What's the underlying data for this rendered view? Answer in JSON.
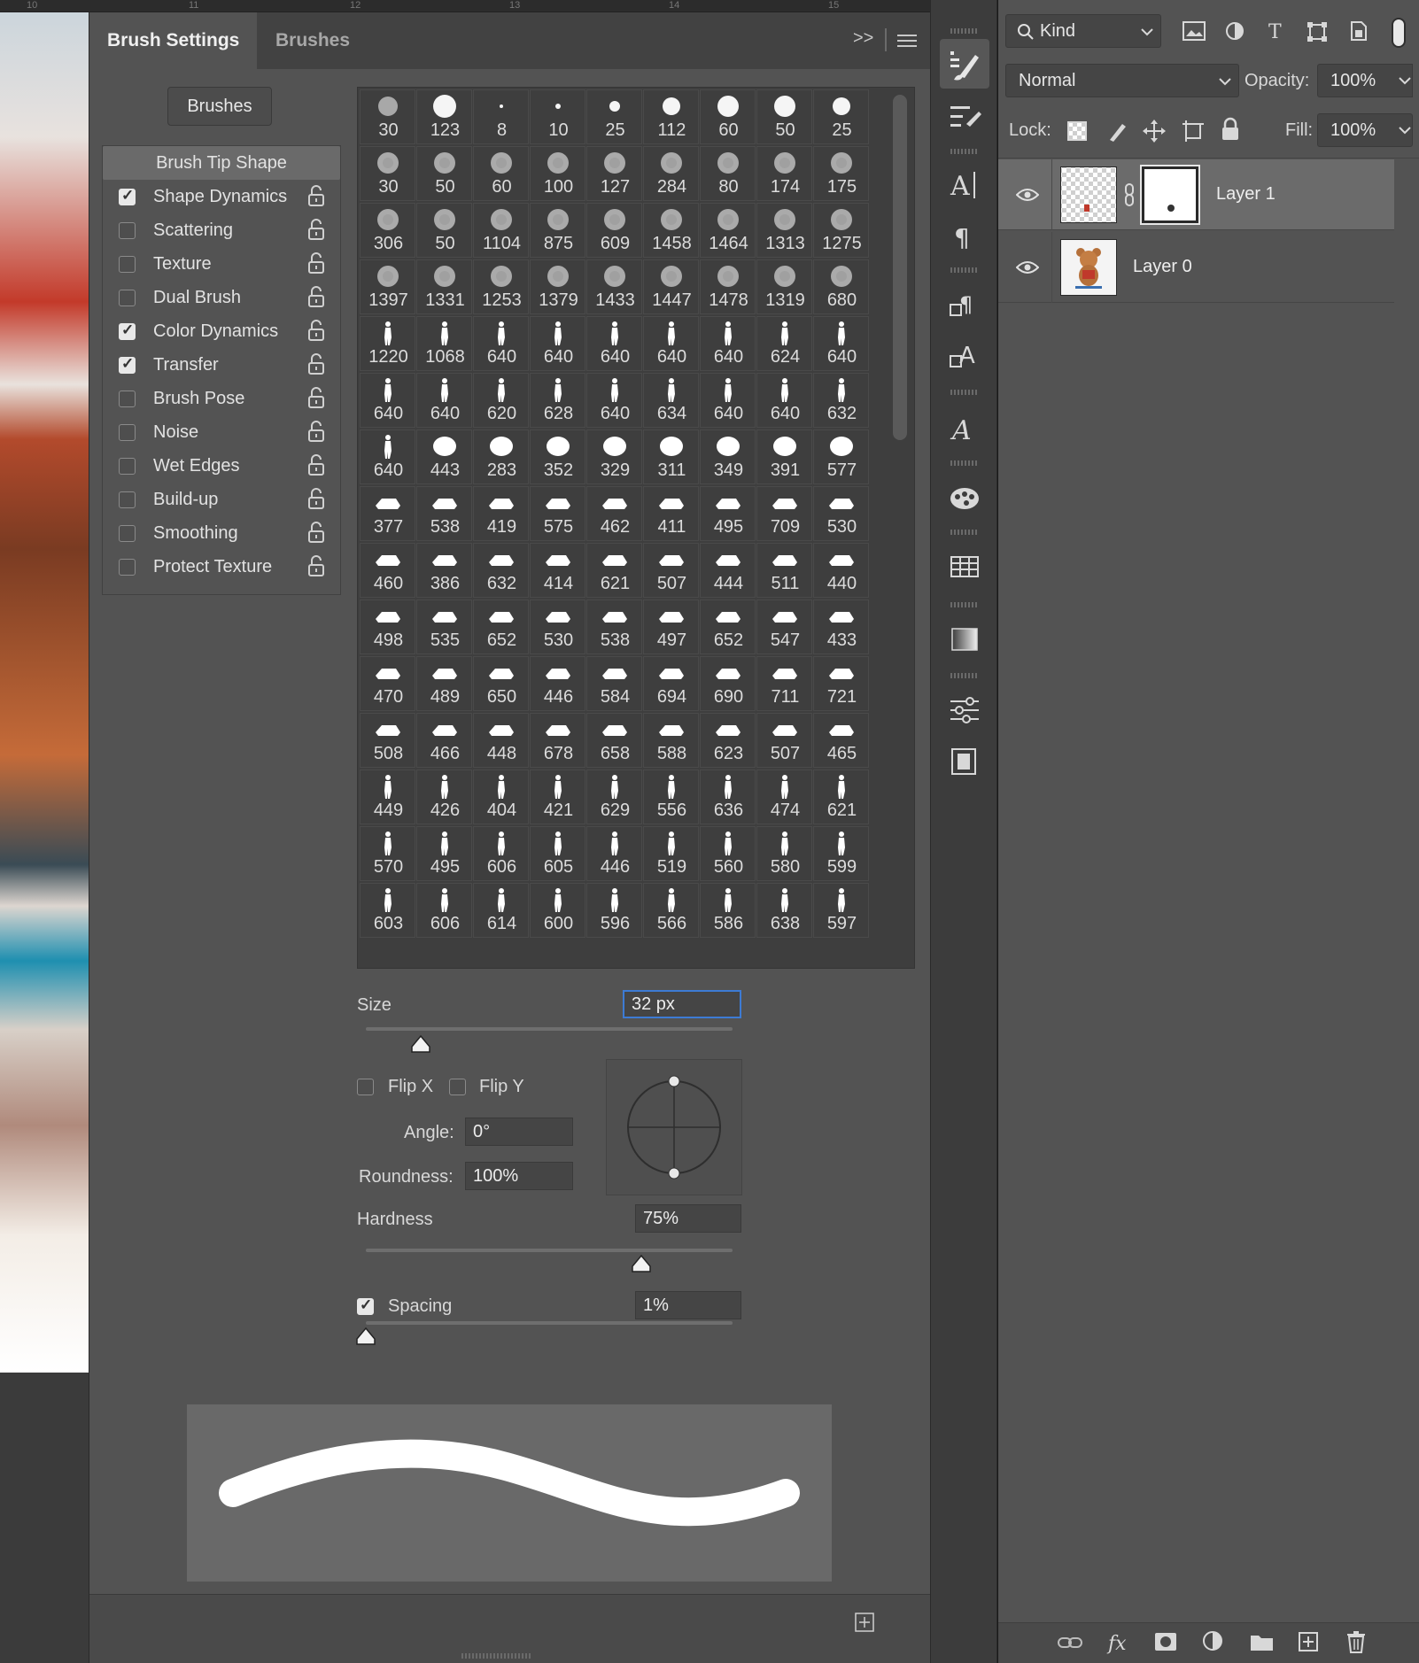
{
  "ruler": {
    "marks": [
      "10",
      "11",
      "12",
      "13",
      "14",
      "15"
    ]
  },
  "brush_settings": {
    "tabs": [
      {
        "label": "Brush Settings"
      },
      {
        "label": "Brushes"
      }
    ],
    "collapse_glyph": ">>",
    "brushes_button": "Brushes",
    "options": [
      {
        "label": "Brush Tip Shape",
        "header": true
      },
      {
        "label": "Shape Dynamics",
        "checked": true
      },
      {
        "label": "Scattering",
        "checked": false
      },
      {
        "label": "Texture",
        "checked": false
      },
      {
        "label": "Dual Brush",
        "checked": false
      },
      {
        "label": "Color Dynamics",
        "checked": true
      },
      {
        "label": "Transfer",
        "checked": true
      },
      {
        "label": "Brush Pose",
        "checked": false
      },
      {
        "label": "Noise",
        "checked": false
      },
      {
        "label": "Wet Edges",
        "checked": false
      },
      {
        "label": "Build-up",
        "checked": false
      },
      {
        "label": "Smoothing",
        "checked": false
      },
      {
        "label": "Protect Texture",
        "checked": false
      }
    ],
    "brush_sizes": [
      30,
      123,
      8,
      10,
      25,
      112,
      60,
      50,
      25,
      30,
      50,
      60,
      100,
      127,
      284,
      80,
      174,
      175,
      306,
      50,
      1104,
      875,
      609,
      1458,
      1464,
      1313,
      1275,
      1397,
      1331,
      1253,
      1379,
      1433,
      1447,
      1478,
      1319,
      680,
      1220,
      1068,
      640,
      640,
      640,
      640,
      640,
      624,
      640,
      640,
      640,
      620,
      628,
      640,
      634,
      640,
      640,
      632,
      640,
      443,
      283,
      352,
      329,
      311,
      349,
      391,
      577,
      377,
      538,
      419,
      575,
      462,
      411,
      495,
      709,
      530,
      460,
      386,
      632,
      414,
      621,
      507,
      444,
      511,
      440,
      498,
      535,
      652,
      530,
      538,
      497,
      652,
      547,
      433,
      470,
      489,
      650,
      446,
      584,
      694,
      690,
      711,
      721,
      508,
      466,
      448,
      678,
      658,
      588,
      623,
      507,
      465,
      449,
      426,
      404,
      421,
      629,
      556,
      636,
      474,
      621,
      570,
      495,
      606,
      605,
      446,
      519,
      560,
      580,
      599,
      603,
      606,
      614,
      600,
      596,
      566,
      586,
      638,
      597
    ],
    "size": {
      "label": "Size",
      "value": "32 px",
      "slider_fraction": 0.15
    },
    "flip_x": {
      "label": "Flip X",
      "checked": false
    },
    "flip_y": {
      "label": "Flip Y",
      "checked": false
    },
    "angle": {
      "label": "Angle:",
      "value": "0°"
    },
    "roundness": {
      "label": "Roundness:",
      "value": "100%"
    },
    "hardness": {
      "label": "Hardness",
      "value": "75%",
      "slider_fraction": 0.75
    },
    "spacing": {
      "label": "Spacing",
      "value": "1%",
      "checked": true,
      "slider_fraction": 0.0
    }
  },
  "layers_panel": {
    "filter": {
      "label": "Kind"
    },
    "blend_mode": "Normal",
    "opacity": {
      "label": "Opacity:",
      "value": "100%"
    },
    "lock": {
      "label": "Lock:"
    },
    "fill": {
      "label": "Fill:",
      "value": "100%"
    },
    "layers": [
      {
        "name": "Layer 1",
        "selected": true,
        "visible": true,
        "has_mask": true
      },
      {
        "name": "Layer 0",
        "selected": false,
        "visible": true,
        "has_mask": false
      }
    ],
    "bottom_actions": [
      "link-icon",
      "fx-icon",
      "mask-icon",
      "adjustment-icon",
      "folder-icon",
      "new-layer-icon",
      "trash-icon"
    ]
  },
  "colors": {
    "panel_bg": "#535353",
    "focus_blue": "#3d7bd4",
    "selected_row": "#6b6b6b"
  }
}
